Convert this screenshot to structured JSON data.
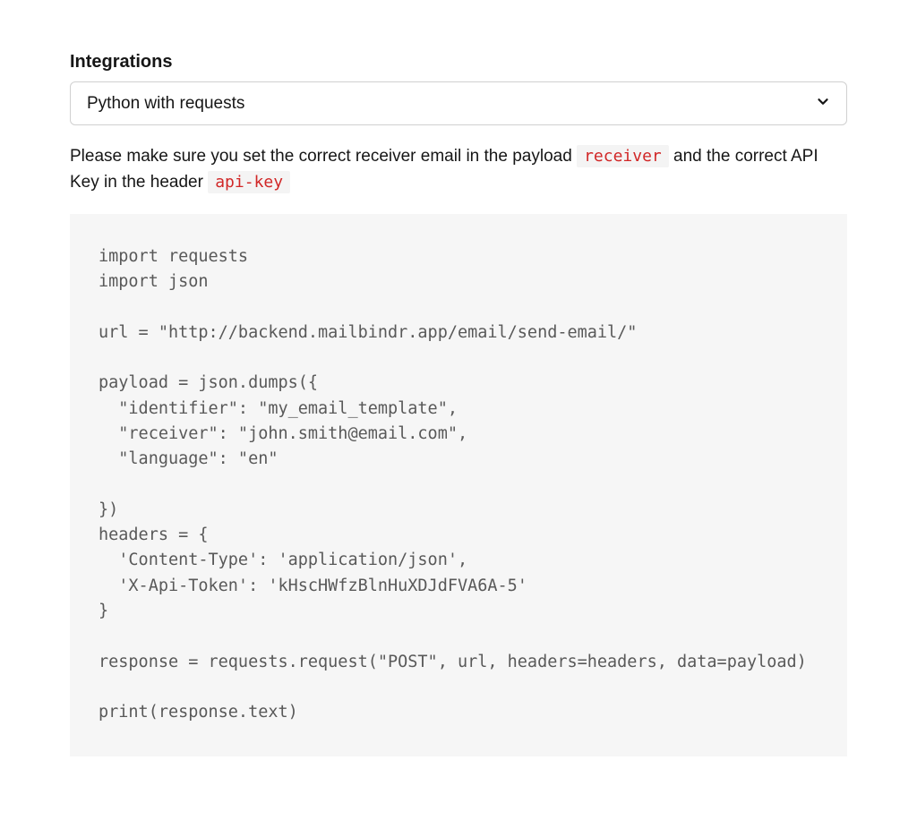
{
  "heading": "Integrations",
  "dropdown": {
    "selected": "Python with requests"
  },
  "description": {
    "part1": "Please make sure you set the correct receiver email in the payload ",
    "code1": "receiver",
    "part2": " and the correct API Key in the header ",
    "code2": "api-key"
  },
  "code": "import requests\nimport json\n\nurl = \"http://backend.mailbindr.app/email/send-email/\"\n\npayload = json.dumps({\n  \"identifier\": \"my_email_template\",\n  \"receiver\": \"john.smith@email.com\",\n  \"language\": \"en\"\n\n})\nheaders = {\n  'Content-Type': 'application/json',\n  'X-Api-Token': 'kHscHWfzBlnHuXDJdFVA6A-5'\n}\n\nresponse = requests.request(\"POST\", url, headers=headers, data=payload)\n\nprint(response.text)"
}
